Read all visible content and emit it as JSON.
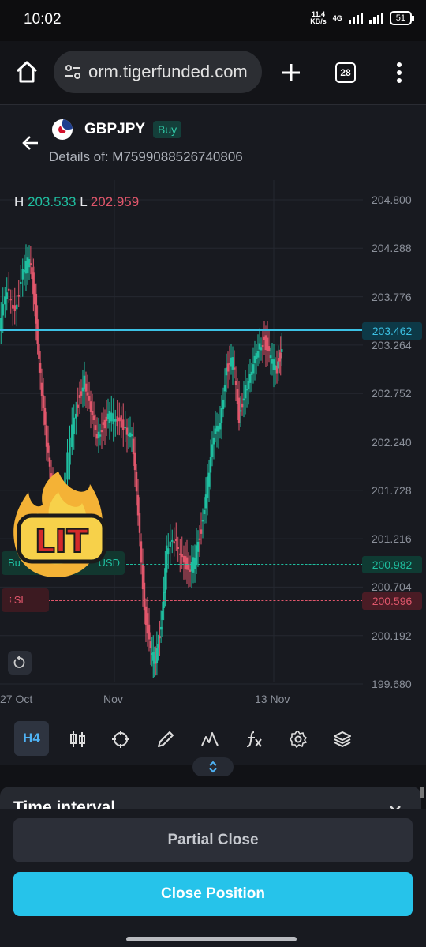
{
  "status_bar": {
    "time": "10:02",
    "net_speed_value": "11.4",
    "net_speed_unit": "KB/s",
    "network_type": "4G",
    "battery": "51"
  },
  "browser": {
    "url": "orm.tigerfunded.com",
    "tab_count": "28"
  },
  "header": {
    "symbol": "GBPJPY",
    "side_badge": "Buy",
    "details": "Details of: M7599088526740806"
  },
  "chart": {
    "high_label": "H",
    "high_value": "203.533",
    "low_label": "L",
    "low_value": "202.959",
    "y_axis": [
      "204.800",
      "204.288",
      "203.776",
      "203.264",
      "202.752",
      "202.240",
      "201.728",
      "201.216",
      "200.704",
      "200.192",
      "199.680"
    ],
    "x_axis": [
      "27 Oct",
      "Nov",
      "13 Nov"
    ],
    "current_price": "203.462",
    "tp_price": "200.982",
    "sl_price": "200.596",
    "buy_tag_text": "Bu",
    "buy_tag_suffix": "USD",
    "sl_tag_text": "SL",
    "sticker_text": "LIT",
    "colors": {
      "up": "#1fbfa0",
      "down": "#e0566b",
      "current_line": "#3cc1e4"
    }
  },
  "toolbar": {
    "interval": "H4",
    "icons": [
      "candles-icon",
      "crosshair-icon",
      "pencil-icon",
      "indicator-icon",
      "fx-icon",
      "settings-icon",
      "layers-icon"
    ]
  },
  "sheet": {
    "title": "Time interval"
  },
  "actions": {
    "partial_close": "Partial Close",
    "close_position": "Close Position"
  }
}
